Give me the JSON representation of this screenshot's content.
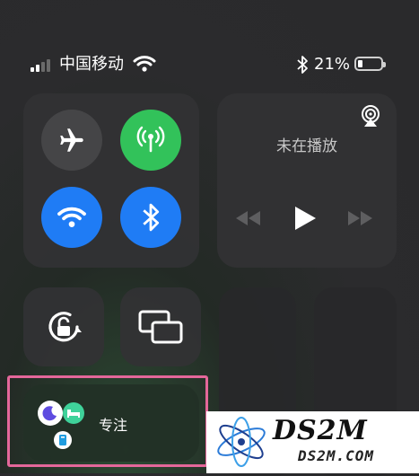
{
  "status_bar": {
    "carrier": "中国移动",
    "battery_percent": "21%",
    "battery_level": 0.21,
    "signal_bars_filled": 2,
    "signal_bars_total": 4
  },
  "connectivity": {
    "airplane": {
      "icon": "airplane-icon",
      "active": false
    },
    "cellular": {
      "icon": "cellular-antenna-icon",
      "active": true,
      "color": "#32c25a"
    },
    "wifi": {
      "icon": "wifi-icon",
      "active": true,
      "color": "#1f7cf5"
    },
    "bluetooth": {
      "icon": "bluetooth-icon",
      "active": true,
      "color": "#1f7cf5"
    }
  },
  "media": {
    "title": "未在播放",
    "airplay_icon": "airplay-icon",
    "controls": [
      "rewind-icon",
      "play-icon",
      "fast-forward-icon"
    ]
  },
  "tiles": {
    "orientation_lock_icon": "orientation-lock-icon",
    "screen_mirroring_icon": "screen-mirroring-icon"
  },
  "focus": {
    "label": "专注",
    "highlight_color": "#e4679a"
  },
  "watermark": {
    "main": "DS2M",
    "sub": "DS2M.COM"
  }
}
